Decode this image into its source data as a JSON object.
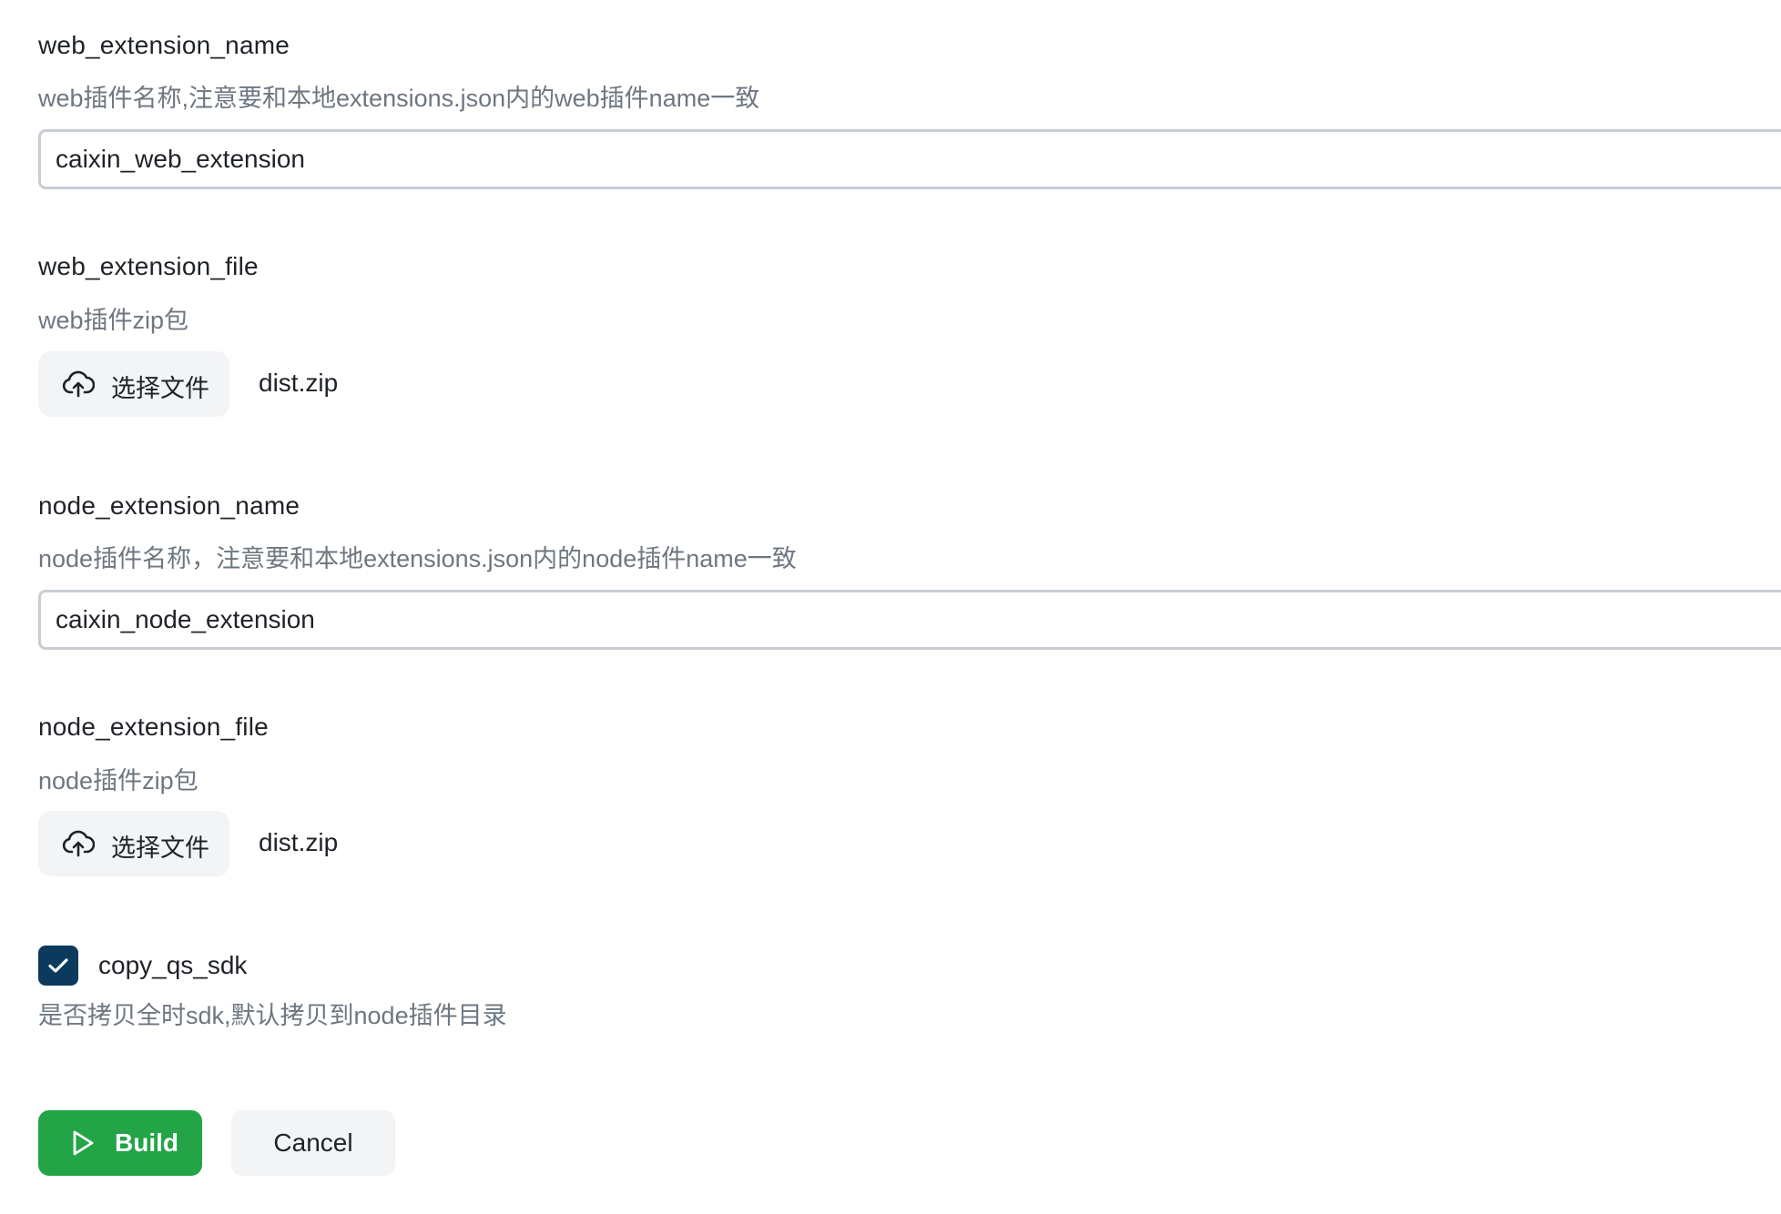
{
  "fields": {
    "web_extension_name": {
      "label": "web_extension_name",
      "description": "web插件名称,注意要和本地extensions.json内的web插件name一致",
      "value": "caixin_web_extension"
    },
    "web_extension_file": {
      "label": "web_extension_file",
      "description": "web插件zip包",
      "button_label": "选择文件",
      "file_name": "dist.zip"
    },
    "node_extension_name": {
      "label": "node_extension_name",
      "description": "node插件名称，注意要和本地extensions.json内的node插件name一致",
      "value": "caixin_node_extension"
    },
    "node_extension_file": {
      "label": "node_extension_file",
      "description": "node插件zip包",
      "button_label": "选择文件",
      "file_name": "dist.zip"
    },
    "copy_qs_sdk": {
      "label": "copy_qs_sdk",
      "description": "是否拷贝全时sdk,默认拷贝到node插件目录",
      "checked": true
    }
  },
  "actions": {
    "build_label": "Build",
    "cancel_label": "Cancel"
  },
  "icons": {
    "upload": "cloud-upload-icon",
    "play": "play-icon",
    "check": "checkmark-icon"
  },
  "colors": {
    "primary_button": "#22a447",
    "checkbox": "#0b3a5c",
    "secondary_button": "#f3f4f6",
    "description_text": "#6e7781",
    "input_border": "#c8cdd3"
  }
}
